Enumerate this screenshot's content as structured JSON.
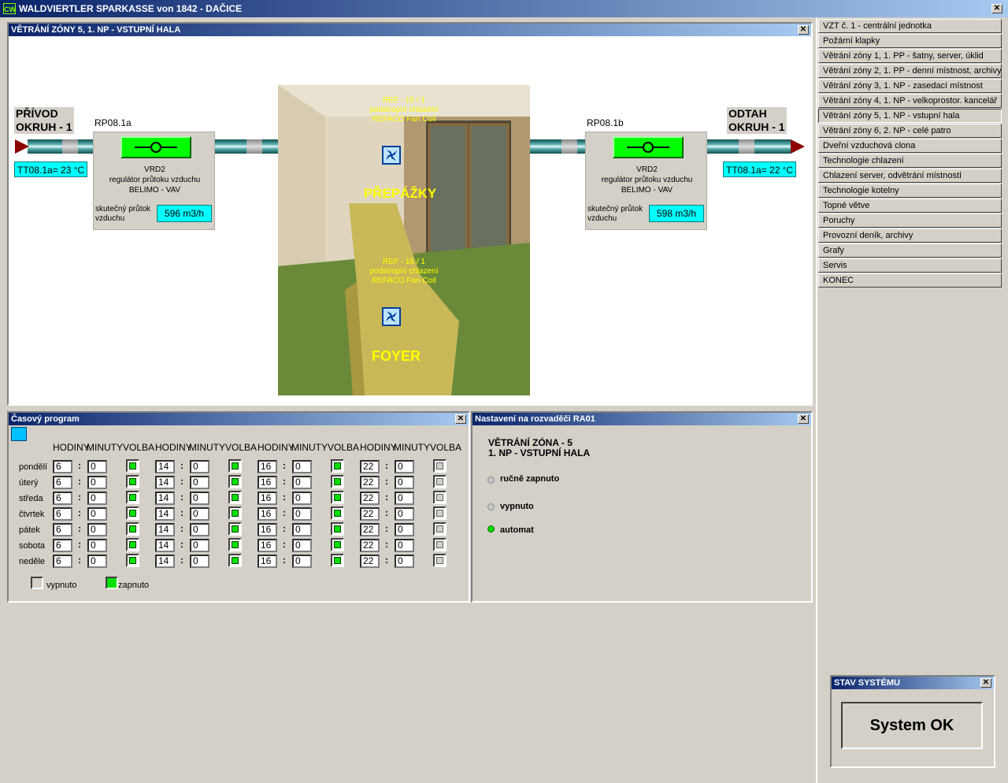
{
  "window": {
    "title": "WALDVIERTLER SPARKASSE von  1842 - DAČICE",
    "logo": "CW",
    "close": "✕"
  },
  "zone": {
    "title": "VĚTRÁNÍ ZÓNY 5, 1. NP - VSTUPNÍ HALA",
    "supply": {
      "label": "PŘÍVOD\nOKRUH - 1",
      "label1": "PŘÍVOD",
      "label2": "OKRUH - 1",
      "temp": "TT08.1a= 23 °C"
    },
    "exhaust": {
      "label1": "ODTAH",
      "label2": "OKRUH - 1",
      "temp": "TT08.1a= 22 °C"
    },
    "vav_left": {
      "id": "RP08.1a",
      "name": "VRD2",
      "desc1": "regulátor průtoku vzduchu",
      "desc2": "BELIMO - VAV",
      "flow_label1": "skutečný průtok",
      "flow_label2": "vzduchu",
      "flow": "596 m3/h"
    },
    "vav_right": {
      "id": "RP08.1b",
      "name": "VRD2",
      "desc1": "regulátor průtoku vzduchu",
      "desc2": "BELIMO - VAV",
      "flow_label1": "skutečný průtok",
      "flow_label2": "vzduchu",
      "flow": "598 m3/h"
    },
    "photo": {
      "ref1": {
        "l1": "REF - 15 / 1",
        "l2": "podstropní chlazení",
        "l3": "REFACO Fan Coil"
      },
      "ref2": {
        "l1": "REF - 16 / 1",
        "l2": "podstropní chlazení",
        "l3": "REFACO Fan Coil"
      },
      "area1": "PŘEPÁŽKY",
      "area2": "FOYER"
    }
  },
  "schedule": {
    "title": "Časový program",
    "headers": [
      "HODINY",
      "MINUTY",
      "VOLBA",
      "HODINY",
      "MINUTY",
      "VOLBA",
      "HODINY",
      "MINUTY",
      "VOLBA",
      "HODINY",
      "MINUTY",
      "VOLBA"
    ],
    "days": [
      {
        "name": "pondělí",
        "h": [
          "6",
          "14",
          "16",
          "22"
        ],
        "m": [
          "0",
          "0",
          "0",
          "0"
        ],
        "on": [
          true,
          true,
          true,
          false
        ]
      },
      {
        "name": "úterý",
        "h": [
          "6",
          "14",
          "16",
          "22"
        ],
        "m": [
          "0",
          "0",
          "0",
          "0"
        ],
        "on": [
          true,
          true,
          true,
          false
        ]
      },
      {
        "name": "středa",
        "h": [
          "6",
          "14",
          "16",
          "22"
        ],
        "m": [
          "0",
          "0",
          "0",
          "0"
        ],
        "on": [
          true,
          true,
          true,
          false
        ]
      },
      {
        "name": "čtvrtek",
        "h": [
          "6",
          "14",
          "16",
          "22"
        ],
        "m": [
          "0",
          "0",
          "0",
          "0"
        ],
        "on": [
          true,
          true,
          true,
          false
        ]
      },
      {
        "name": "pátek",
        "h": [
          "6",
          "14",
          "16",
          "22"
        ],
        "m": [
          "0",
          "0",
          "0",
          "0"
        ],
        "on": [
          true,
          true,
          true,
          false
        ]
      },
      {
        "name": "sobota",
        "h": [
          "6",
          "14",
          "16",
          "22"
        ],
        "m": [
          "0",
          "0",
          "0",
          "0"
        ],
        "on": [
          true,
          true,
          true,
          false
        ]
      },
      {
        "name": "neděle",
        "h": [
          "6",
          "14",
          "16",
          "22"
        ],
        "m": [
          "0",
          "0",
          "0",
          "0"
        ],
        "on": [
          true,
          true,
          true,
          false
        ]
      }
    ],
    "legend_off": "vypnuto",
    "legend_on": "zapnuto"
  },
  "settings": {
    "title": "Nastavení na rozvaděči RA01",
    "heading1": "VĚTRÁNÍ ZÓNA - 5",
    "heading2": "1. NP - VSTUPNÍ HALA",
    "options": [
      {
        "label": "ručně zapnuto",
        "active": false
      },
      {
        "label": "vypnuto",
        "active": false
      },
      {
        "label": "automat",
        "active": true
      }
    ]
  },
  "menu": {
    "items": [
      "VZT č. 1 - centrální jednotka",
      "Požární klapky",
      "Větrání zóny 1, 1. PP - šatny, server, úklid",
      "Větrání zóny 2, 1. PP - denní místnost, archivy",
      "Větrání zóny 3, 1. NP - zasedací místnost",
      "Větrání zóny 4, 1. NP - velkoprostor. kancelář",
      "Větrání zóny 5, 1. NP - vstupní hala",
      "Větrání zóny 6, 2. NP - celé patro",
      "Dveřní vzduchová clona",
      "Technologie chlazení",
      "Chlazení server, odvětrání místností",
      "Technologie kotelny",
      "Topné větve",
      "Poruchy",
      "Provozní deník, archivy",
      "Grafy",
      "Servis",
      "KONEC"
    ],
    "active_index": 6
  },
  "status": {
    "title": "STAV SYSTÉMU",
    "text": "System OK"
  },
  "colors": {
    "title_bar": "#0a246a",
    "cyan": "#00ffff",
    "green": "#00ff00",
    "photo_text": "#ffff00"
  }
}
